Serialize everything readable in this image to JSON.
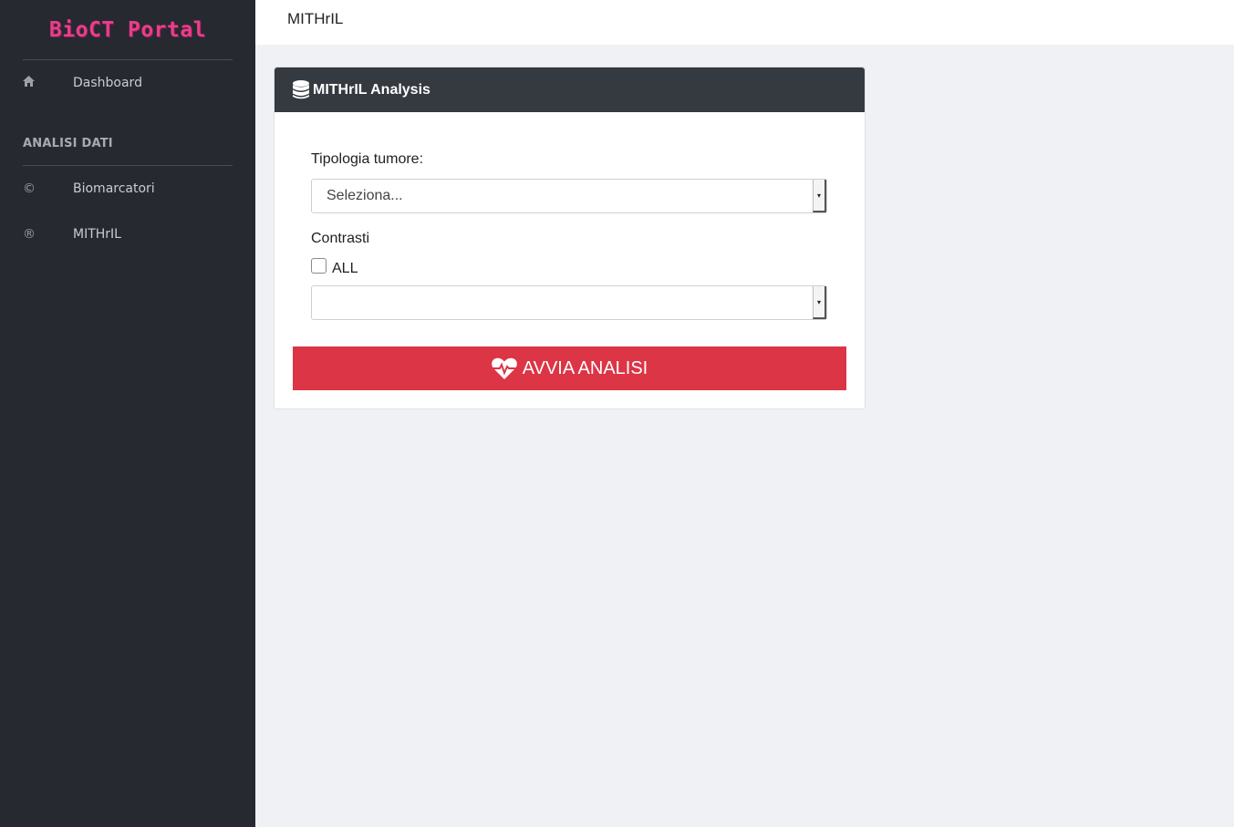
{
  "app": {
    "brand": "BioCT Portal",
    "page_title": "MITHrIL"
  },
  "sidebar": {
    "items": [
      {
        "label": "Dashboard",
        "icon": "home-icon",
        "glyph": "⌂"
      }
    ],
    "section_title": "ANALISI DATI",
    "section_items": [
      {
        "label": "Biomarcatori",
        "icon": "copyright-icon",
        "glyph": "©"
      },
      {
        "label": "MITHrIL",
        "icon": "registered-icon",
        "glyph": "®"
      }
    ]
  },
  "card": {
    "title": "MITHrIL Analysis",
    "icon": "database-icon",
    "tumor_label": "Tipologia tumore:",
    "tumor_select_value": "Seleziona...",
    "contrasts_label": "Contrasti",
    "all_checkbox_label": "ALL",
    "contrasts_select_value": "",
    "run_button_label": "AVVIA ANALISI",
    "run_button_icon": "heartbeat-icon"
  },
  "colors": {
    "sidebar_bg": "#262a30",
    "brand": "#e83e8c",
    "card_header_bg": "#343a40",
    "button_bg": "#dc3545",
    "page_bg": "#f0f1f5"
  }
}
